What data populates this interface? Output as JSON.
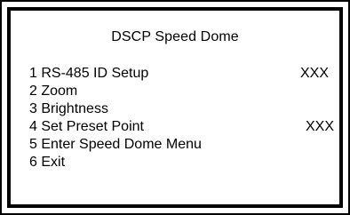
{
  "menu": {
    "title": "DSCP Speed Dome",
    "items": [
      {
        "label": "1 RS-485 ID Setup",
        "value": "XXX"
      },
      {
        "label": "2 Zoom"
      },
      {
        "label": "3 Brightness"
      },
      {
        "label": "4 Set Preset Point",
        "value": "XXX"
      },
      {
        "label": "5 Enter Speed Dome Menu"
      },
      {
        "label": "6 Exit"
      }
    ]
  },
  "colors": {
    "background": "#ffffff",
    "border": "#000000",
    "text": "#000000"
  }
}
